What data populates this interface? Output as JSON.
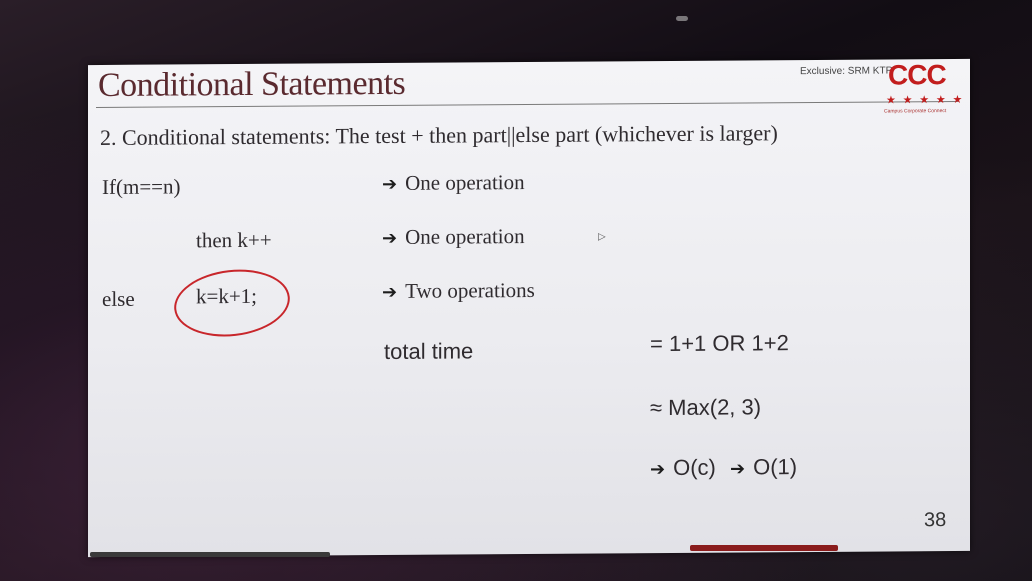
{
  "slide": {
    "title": "Conditional Statements",
    "exclusive": "Exclusive: SRM KTR",
    "logo_text": "CCC",
    "logo_stars": "★ ★ ★ ★ ★",
    "logo_subtitle": "Campus Corporate Connect",
    "subtitle": "2. Conditional statements: The test + then part||else part (whichever is larger)",
    "lines": {
      "if_condition": "If(m==n)",
      "if_cost": "One operation",
      "then_stmt": "then k++",
      "then_cost": "One operation",
      "else_kw": "else",
      "else_stmt": "k=k+1;",
      "else_cost": "Two operations",
      "total_label": "total time",
      "total_value": "= 1+1 OR 1+2",
      "max_value": "≈ Max(2, 3)",
      "order_c": "O(c)",
      "order_1": "O(1)"
    },
    "arrow_glyph": "➔",
    "page_number": "38"
  },
  "colors": {
    "title": "#5a2a2f",
    "logo": "#c21d1d",
    "annotation_circle": "#c8262b",
    "text": "#2f2b2f"
  }
}
